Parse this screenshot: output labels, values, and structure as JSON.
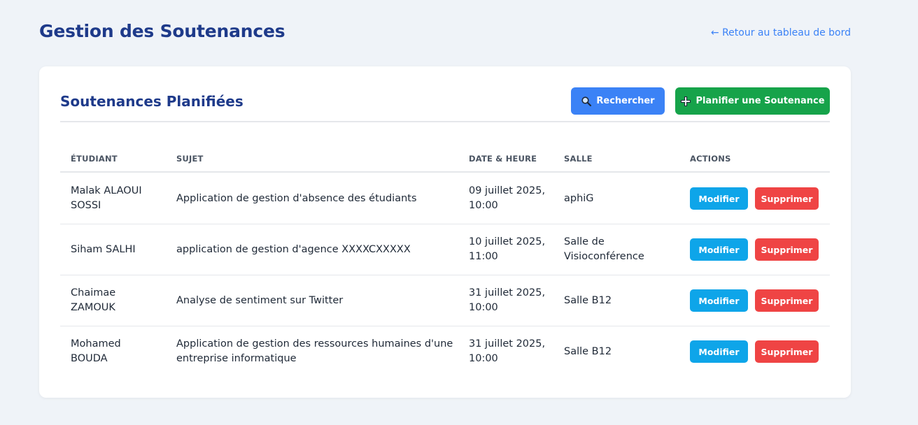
{
  "header": {
    "title": "Gestion des Soutenances",
    "back_link": "← Retour au tableau de bord"
  },
  "card": {
    "title": "Soutenances Planifiées",
    "search_label": "Rechercher",
    "plan_label": "Planifier une Soutenance",
    "search_icon": "magnifier-icon",
    "plan_icon": "plus-icon"
  },
  "table": {
    "columns": {
      "student": "Étudiant",
      "subject": "Sujet",
      "date": "Date & Heure",
      "room": "Salle",
      "actions": "Actions"
    },
    "edit_label": "Modifier",
    "delete_label": "Supprimer",
    "rows": [
      {
        "student": "Malak ALAOUI SOSSI",
        "subject": "Application de gestion d'absence des étudiants",
        "date": "09 juillet 2025, 10:00",
        "room": "aphiG"
      },
      {
        "student": "Siham SALHI",
        "subject": "application de gestion d'agence XXXXCXXXXX",
        "date": "10 juillet 2025, 11:00",
        "room": "Salle de Visioconférence"
      },
      {
        "student": "Chaimae ZAMOUK",
        "subject": "Analyse de sentiment sur Twitter",
        "date": "31 juillet 2025, 10:00",
        "room": "Salle B12"
      },
      {
        "student": "Mohamed BOUDA",
        "subject": "Application de gestion des ressources humaines d'une entreprise informatique",
        "date": "31 juillet 2025, 10:00",
        "room": "Salle B12"
      }
    ]
  },
  "colors": {
    "title": "#1e3a8a",
    "link": "#3b82f6",
    "search_button": "#3b82f6",
    "plan_button": "#16a34a",
    "edit_button": "#0ea5e9",
    "delete_button": "#ef4444",
    "background": "#eff3f8"
  }
}
